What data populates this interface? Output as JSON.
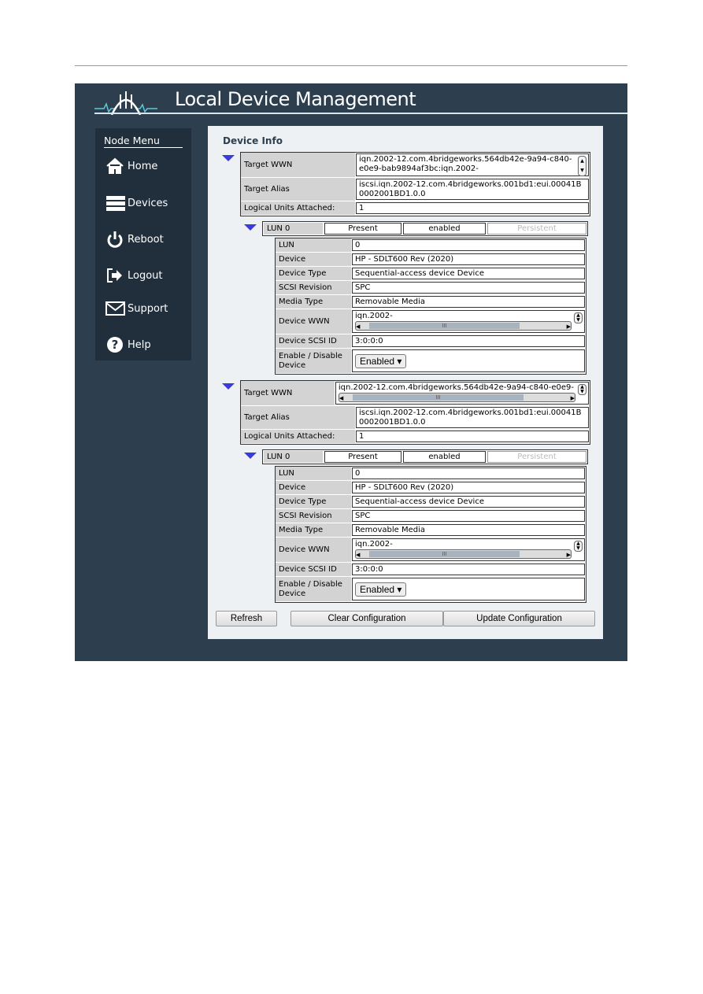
{
  "app": {
    "title": "Local Device Management"
  },
  "sidebar": {
    "title": "Node Menu",
    "items": [
      {
        "label": "Home",
        "icon": "home-icon"
      },
      {
        "label": "Devices",
        "icon": "devices-icon"
      },
      {
        "label": "Reboot",
        "icon": "power-icon"
      },
      {
        "label": "Logout",
        "icon": "logout-icon"
      },
      {
        "label": "Support",
        "icon": "envelope-icon"
      },
      {
        "label": "Help",
        "icon": "help-icon"
      }
    ]
  },
  "main": {
    "title": "Device Info",
    "labels": {
      "target_wwn": "Target WWN",
      "target_alias": "Target Alias",
      "lua": "Logical Units Attached:",
      "lun": "LUN",
      "device": "Device",
      "device_type": "Device Type",
      "scsi_revision": "SCSI Revision",
      "media_type": "Media Type",
      "device_wwn": "Device WWN",
      "scsi_id": "Device SCSI ID",
      "enable": "Enable / Disable Device"
    },
    "targets": [
      {
        "wwn": "iqn.2002-12.com.4bridgeworks.564db42e-9a94-c840-e0e9-bab9894af3bc:iqn.2002-",
        "alias": "iscsi.iqn.2002-12.com.4bridgeworks.001bd1:eui.00041B0002001BD1.0.0",
        "lua": "1",
        "lun": {
          "name": "LUN 0",
          "present": "Present",
          "enabled": "enabled",
          "persistent": "Persistent",
          "lun": "0",
          "device": "HP - SDLT600 Rev (2020)",
          "device_type": "Sequential-access device Device",
          "scsi_revision": "SPC",
          "media_type": "Removable Media",
          "device_wwn": "iqn.2002-",
          "scsi_id": "3:0:0:0",
          "enable": "Enabled"
        }
      },
      {
        "wwn": "iqn.2002-12.com.4bridgeworks.564db42e-9a94-c840-e0e9-",
        "alias": "iscsi.iqn.2002-12.com.4bridgeworks.001bd1:eui.00041B0002001BD1.0.0",
        "lua": "1",
        "lun": {
          "name": "LUN 0",
          "present": "Present",
          "enabled": "enabled",
          "persistent": "Persistent",
          "lun": "0",
          "device": "HP - SDLT600 Rev (2020)",
          "device_type": "Sequential-access device Device",
          "scsi_revision": "SPC",
          "media_type": "Removable Media",
          "device_wwn": "iqn.2002-",
          "scsi_id": "3:0:0:0",
          "enable": "Enabled"
        }
      }
    ]
  },
  "buttons": {
    "refresh": "Refresh",
    "clear": "Clear Configuration",
    "update": "Update Configuration"
  },
  "colors": {
    "frame": "#2d3e4f",
    "sidebar": "#212f3c",
    "panel": "#eef1f3",
    "triangle": "#3b3bd9"
  }
}
